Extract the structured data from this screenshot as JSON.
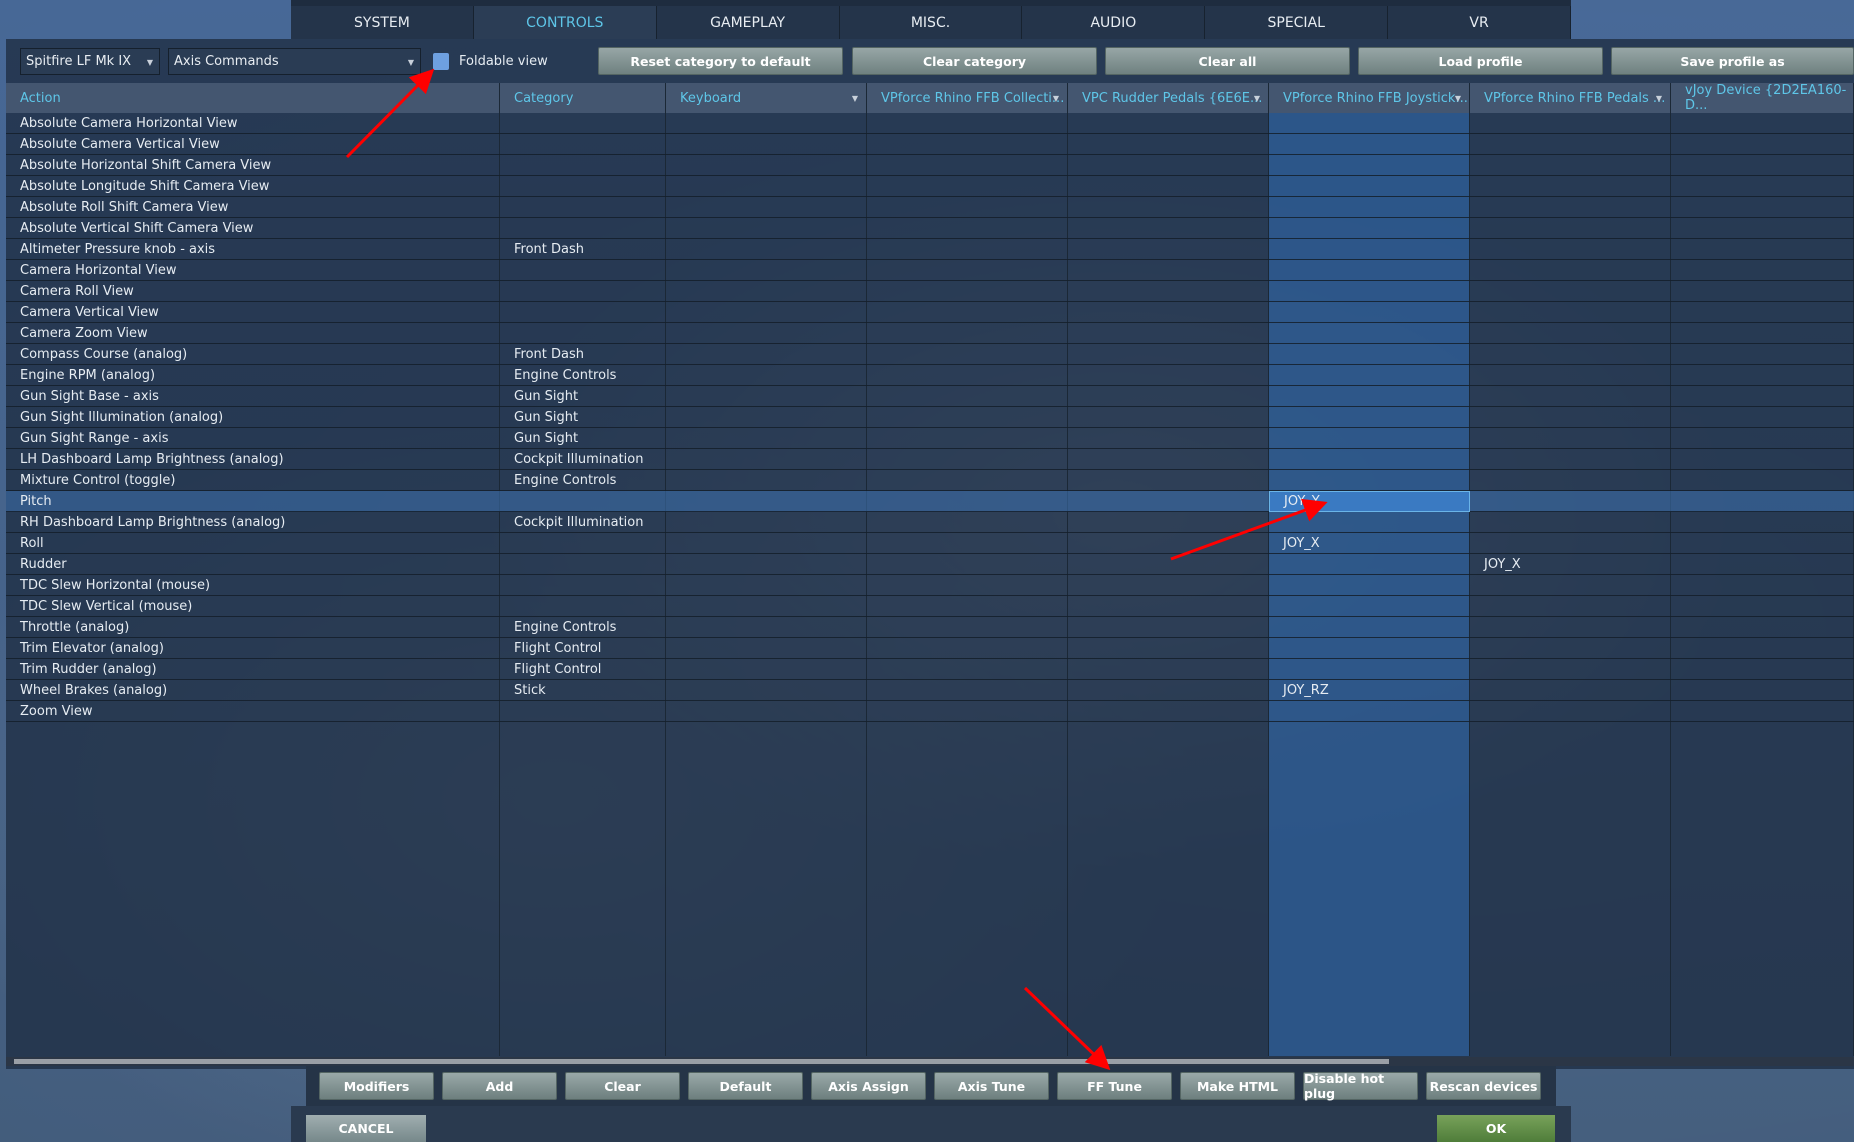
{
  "tabs": [
    "SYSTEM",
    "CONTROLS",
    "GAMEPLAY",
    "MISC.",
    "AUDIO",
    "SPECIAL",
    "VR"
  ],
  "active_tab": "CONTROLS",
  "toolbar": {
    "aircraft": "Spitfire LF Mk IX",
    "category_filter": "Axis Commands",
    "foldable_label": "Foldable view",
    "foldable_checked": true,
    "buttons": [
      "Reset category to default",
      "Clear category",
      "Clear all",
      "Load profile",
      "Save profile as"
    ]
  },
  "columns": [
    "Action",
    "Category",
    "Keyboard",
    "VPforce Rhino FFB Collecti...",
    "VPC Rudder Pedals {6E6E...",
    "VPforce Rhino FFB Joystick...",
    "VPforce Rhino FFB Pedals ...",
    "vJoy Device {2D2EA160-D..."
  ],
  "rows": [
    [
      "Absolute Camera Horizontal View",
      "",
      "",
      "",
      "",
      "",
      "",
      ""
    ],
    [
      "Absolute Camera Vertical View",
      "",
      "",
      "",
      "",
      "",
      "",
      ""
    ],
    [
      "Absolute Horizontal Shift Camera View",
      "",
      "",
      "",
      "",
      "",
      "",
      ""
    ],
    [
      "Absolute Longitude Shift Camera View",
      "",
      "",
      "",
      "",
      "",
      "",
      ""
    ],
    [
      "Absolute Roll Shift Camera View",
      "",
      "",
      "",
      "",
      "",
      "",
      ""
    ],
    [
      "Absolute Vertical Shift Camera View",
      "",
      "",
      "",
      "",
      "",
      "",
      ""
    ],
    [
      "Altimeter Pressure knob - axis",
      "Front Dash",
      "",
      "",
      "",
      "",
      "",
      ""
    ],
    [
      "Camera Horizontal View",
      "",
      "",
      "",
      "",
      "",
      "",
      ""
    ],
    [
      "Camera Roll View",
      "",
      "",
      "",
      "",
      "",
      "",
      ""
    ],
    [
      "Camera Vertical View",
      "",
      "",
      "",
      "",
      "",
      "",
      ""
    ],
    [
      "Camera Zoom View",
      "",
      "",
      "",
      "",
      "",
      "",
      ""
    ],
    [
      "Compass Course (analog)",
      "Front Dash",
      "",
      "",
      "",
      "",
      "",
      ""
    ],
    [
      "Engine RPM (analog)",
      "Engine Controls",
      "",
      "",
      "",
      "",
      "",
      ""
    ],
    [
      "Gun Sight Base - axis",
      "Gun Sight",
      "",
      "",
      "",
      "",
      "",
      ""
    ],
    [
      "Gun Sight Illumination (analog)",
      "Gun Sight",
      "",
      "",
      "",
      "",
      "",
      ""
    ],
    [
      "Gun Sight Range - axis",
      "Gun Sight",
      "",
      "",
      "",
      "",
      "",
      ""
    ],
    [
      "LH Dashboard Lamp Brightness (analog)",
      "Cockpit Illumination",
      "",
      "",
      "",
      "",
      "",
      ""
    ],
    [
      "Mixture Control (toggle)",
      "Engine Controls",
      "",
      "",
      "",
      "",
      "",
      ""
    ],
    [
      "Pitch",
      "",
      "",
      "",
      "",
      "JOY_Y",
      "",
      ""
    ],
    [
      "RH Dashboard Lamp Brightness (analog)",
      "Cockpit Illumination",
      "",
      "",
      "",
      "",
      "",
      ""
    ],
    [
      "Roll",
      "",
      "",
      "",
      "",
      "JOY_X",
      "",
      ""
    ],
    [
      "Rudder",
      "",
      "",
      "",
      "",
      "",
      "JOY_X",
      ""
    ],
    [
      "TDC Slew Horizontal (mouse)",
      "",
      "",
      "",
      "",
      "",
      "",
      ""
    ],
    [
      "TDC Slew Vertical (mouse)",
      "",
      "",
      "",
      "",
      "",
      "",
      ""
    ],
    [
      "Throttle (analog)",
      "Engine Controls",
      "",
      "",
      "",
      "",
      "",
      ""
    ],
    [
      "Trim Elevator (analog)",
      "Flight Control",
      "",
      "",
      "",
      "",
      "",
      ""
    ],
    [
      "Trim Rudder (analog)",
      "Flight Control",
      "",
      "",
      "",
      "",
      "",
      ""
    ],
    [
      "Wheel Brakes (analog)",
      "Stick",
      "",
      "",
      "",
      "JOY_RZ",
      "",
      ""
    ],
    [
      "Zoom View",
      "",
      "",
      "",
      "",
      "",
      "",
      ""
    ]
  ],
  "selected_row": "Pitch",
  "highlighted_column": "VPforce Rhino FFB Joystick...",
  "bottom_buttons": [
    "Modifiers",
    "Add",
    "Clear",
    "Default",
    "Axis Assign",
    "Axis Tune",
    "FF Tune",
    "Make HTML",
    "Disable hot plug",
    "Rescan devices"
  ],
  "cancel_label": "CANCEL",
  "ok_label": "OK",
  "colors": {
    "accent": "#5ec6e8",
    "ok": "#5a8a44",
    "annotation_arrow": "#ff0000"
  }
}
